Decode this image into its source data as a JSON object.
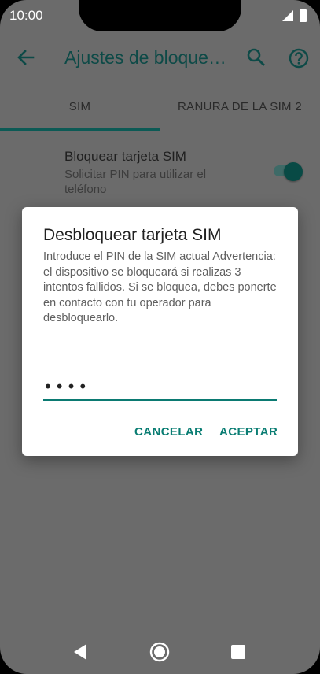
{
  "status_bar": {
    "time": "10:00",
    "signal_icon": "signal-icon",
    "battery_icon": "battery-icon"
  },
  "app_bar": {
    "title": "Ajustes de bloque…",
    "back_icon": "arrow-back-icon",
    "search_icon": "search-icon",
    "help_icon": "help-circle-icon"
  },
  "tabs": [
    {
      "label": "SIM",
      "selected": true
    },
    {
      "label": "RANURA DE LA SIM 2",
      "selected": false
    }
  ],
  "setting": {
    "title": "Bloquear tarjeta SIM",
    "subtitle": "Solicitar PIN para utilizar el teléfono",
    "toggle_on": true
  },
  "dialog": {
    "title": "Desbloquear tarjeta SIM",
    "message": "Introduce el PIN de la SIM actual Advertencia: el dispositivo se bloqueará si realizas 3 intentos fallidos. Si se bloquea, debes ponerte en contacto con tu operador para desbloquearlo.",
    "pin_value": "••••",
    "cancel_label": "CANCELAR",
    "accept_label": "ACEPTAR"
  },
  "colors": {
    "accent": "#0a7d73",
    "scrim_background": "#6b6b6b",
    "app_bar_title": "#0d4a47"
  },
  "nav_bar": {
    "back_icon": "nav-back-icon",
    "home_icon": "nav-home-icon",
    "recents_icon": "nav-recents-icon"
  }
}
